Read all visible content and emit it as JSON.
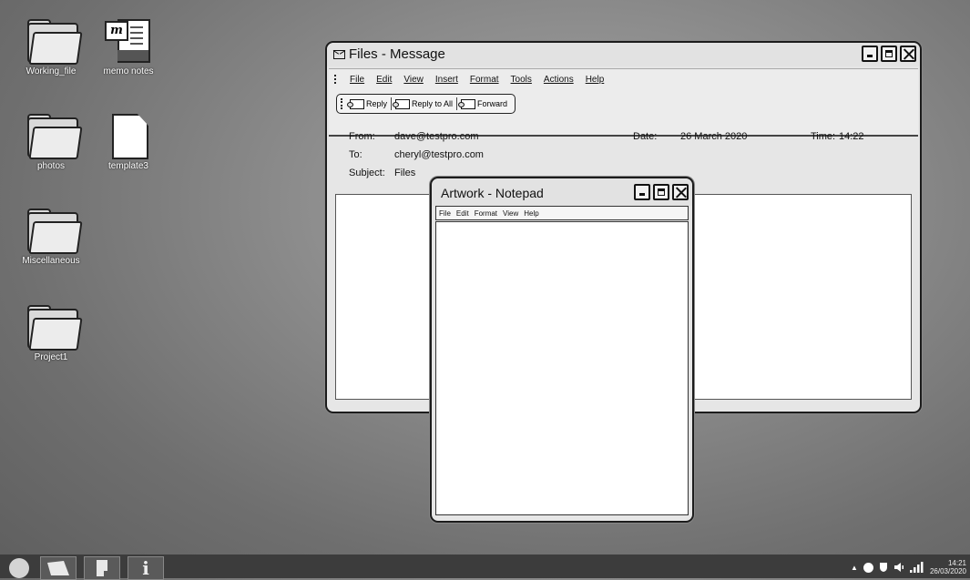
{
  "desktop": {
    "icons": [
      {
        "label": "Working_file",
        "type": "folder"
      },
      {
        "label": "memo notes",
        "type": "memo"
      },
      {
        "label": "photos",
        "type": "folder"
      },
      {
        "label": "template3",
        "type": "document"
      },
      {
        "label": "Miscellaneous",
        "type": "folder"
      },
      {
        "label": "Project1",
        "type": "folder"
      }
    ]
  },
  "message_window": {
    "title": "Files - Message",
    "menu": [
      "File",
      "Edit",
      "View",
      "Insert",
      "Format",
      "Tools",
      "Actions",
      "Help"
    ],
    "toolbar": {
      "reply": "Reply",
      "reply_all": "Reply to All",
      "forward": "Forward"
    },
    "from_label": "From:",
    "from_value": "dave@testpro.com",
    "to_label": "To:",
    "to_value": "cheryl@testpro.com",
    "subject_label": "Subject:",
    "subject_value": "Files",
    "date_label": "Date:",
    "date_value": "26 March 2020",
    "time_label": "Time:",
    "time_value": "14:22"
  },
  "notepad_window": {
    "title": "Artwork - Notepad",
    "menu": [
      "File",
      "Edit",
      "Format",
      "View",
      "Help"
    ]
  },
  "taskbar": {
    "time": "14:21",
    "date": "26/03/2020",
    "info_label": "i"
  }
}
